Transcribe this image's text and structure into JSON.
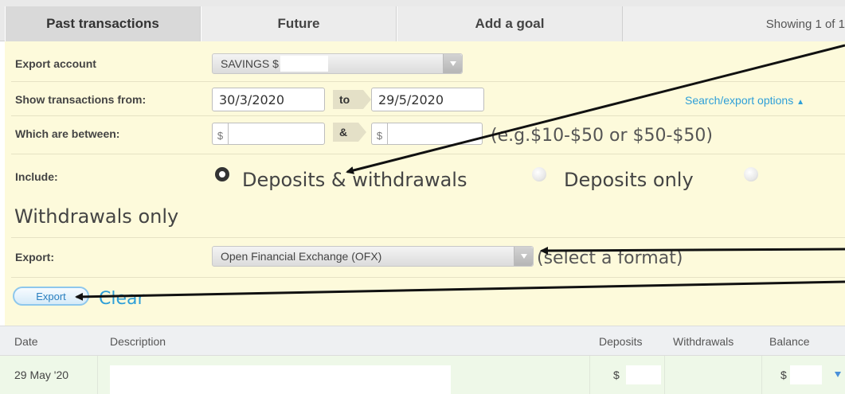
{
  "tabs": {
    "past": "Past transactions",
    "future": "Future",
    "goal": "Add a goal",
    "showing": "Showing 1 of 1"
  },
  "form": {
    "export_account_label": "Export account",
    "export_account_value": "SAVINGS $",
    "show_from_label": "Show transactions from:",
    "from_date": "30/3/2020",
    "to_label": "to",
    "to_date": "29/5/2020",
    "search_options_link": "Search/export options",
    "between_label": "Which are between:",
    "dollar_symbol": "$",
    "and_label": "&",
    "range_hint": "(e.g.$10-$50 or $50-$50)",
    "include_label": "Include:",
    "include_options": [
      "Deposits & withdrawals",
      "Deposits only",
      "Withdrawals only"
    ],
    "include_selected": "Deposits & withdrawals",
    "export_label": "Export:",
    "export_format": "Open Financial Exchange (OFX)",
    "export_hint": "(select a format)",
    "export_button": "Export",
    "clear_link": "Clear"
  },
  "table": {
    "columns": [
      "Date",
      "Description",
      "Deposits",
      "Withdrawals",
      "Balance"
    ],
    "rows": [
      {
        "date": "29 May '20",
        "description": "",
        "deposits": "$",
        "withdrawals": "",
        "balance": "$"
      }
    ]
  },
  "icons": {
    "search_options": "up-arrow-icon",
    "select_arrow": "chevron-down-icon",
    "row_expand": "chevron-down-icon"
  },
  "colors": {
    "panel_bg": "#fdfadb",
    "link": "#2e9fd8",
    "row_bg": "#eef8e8"
  }
}
